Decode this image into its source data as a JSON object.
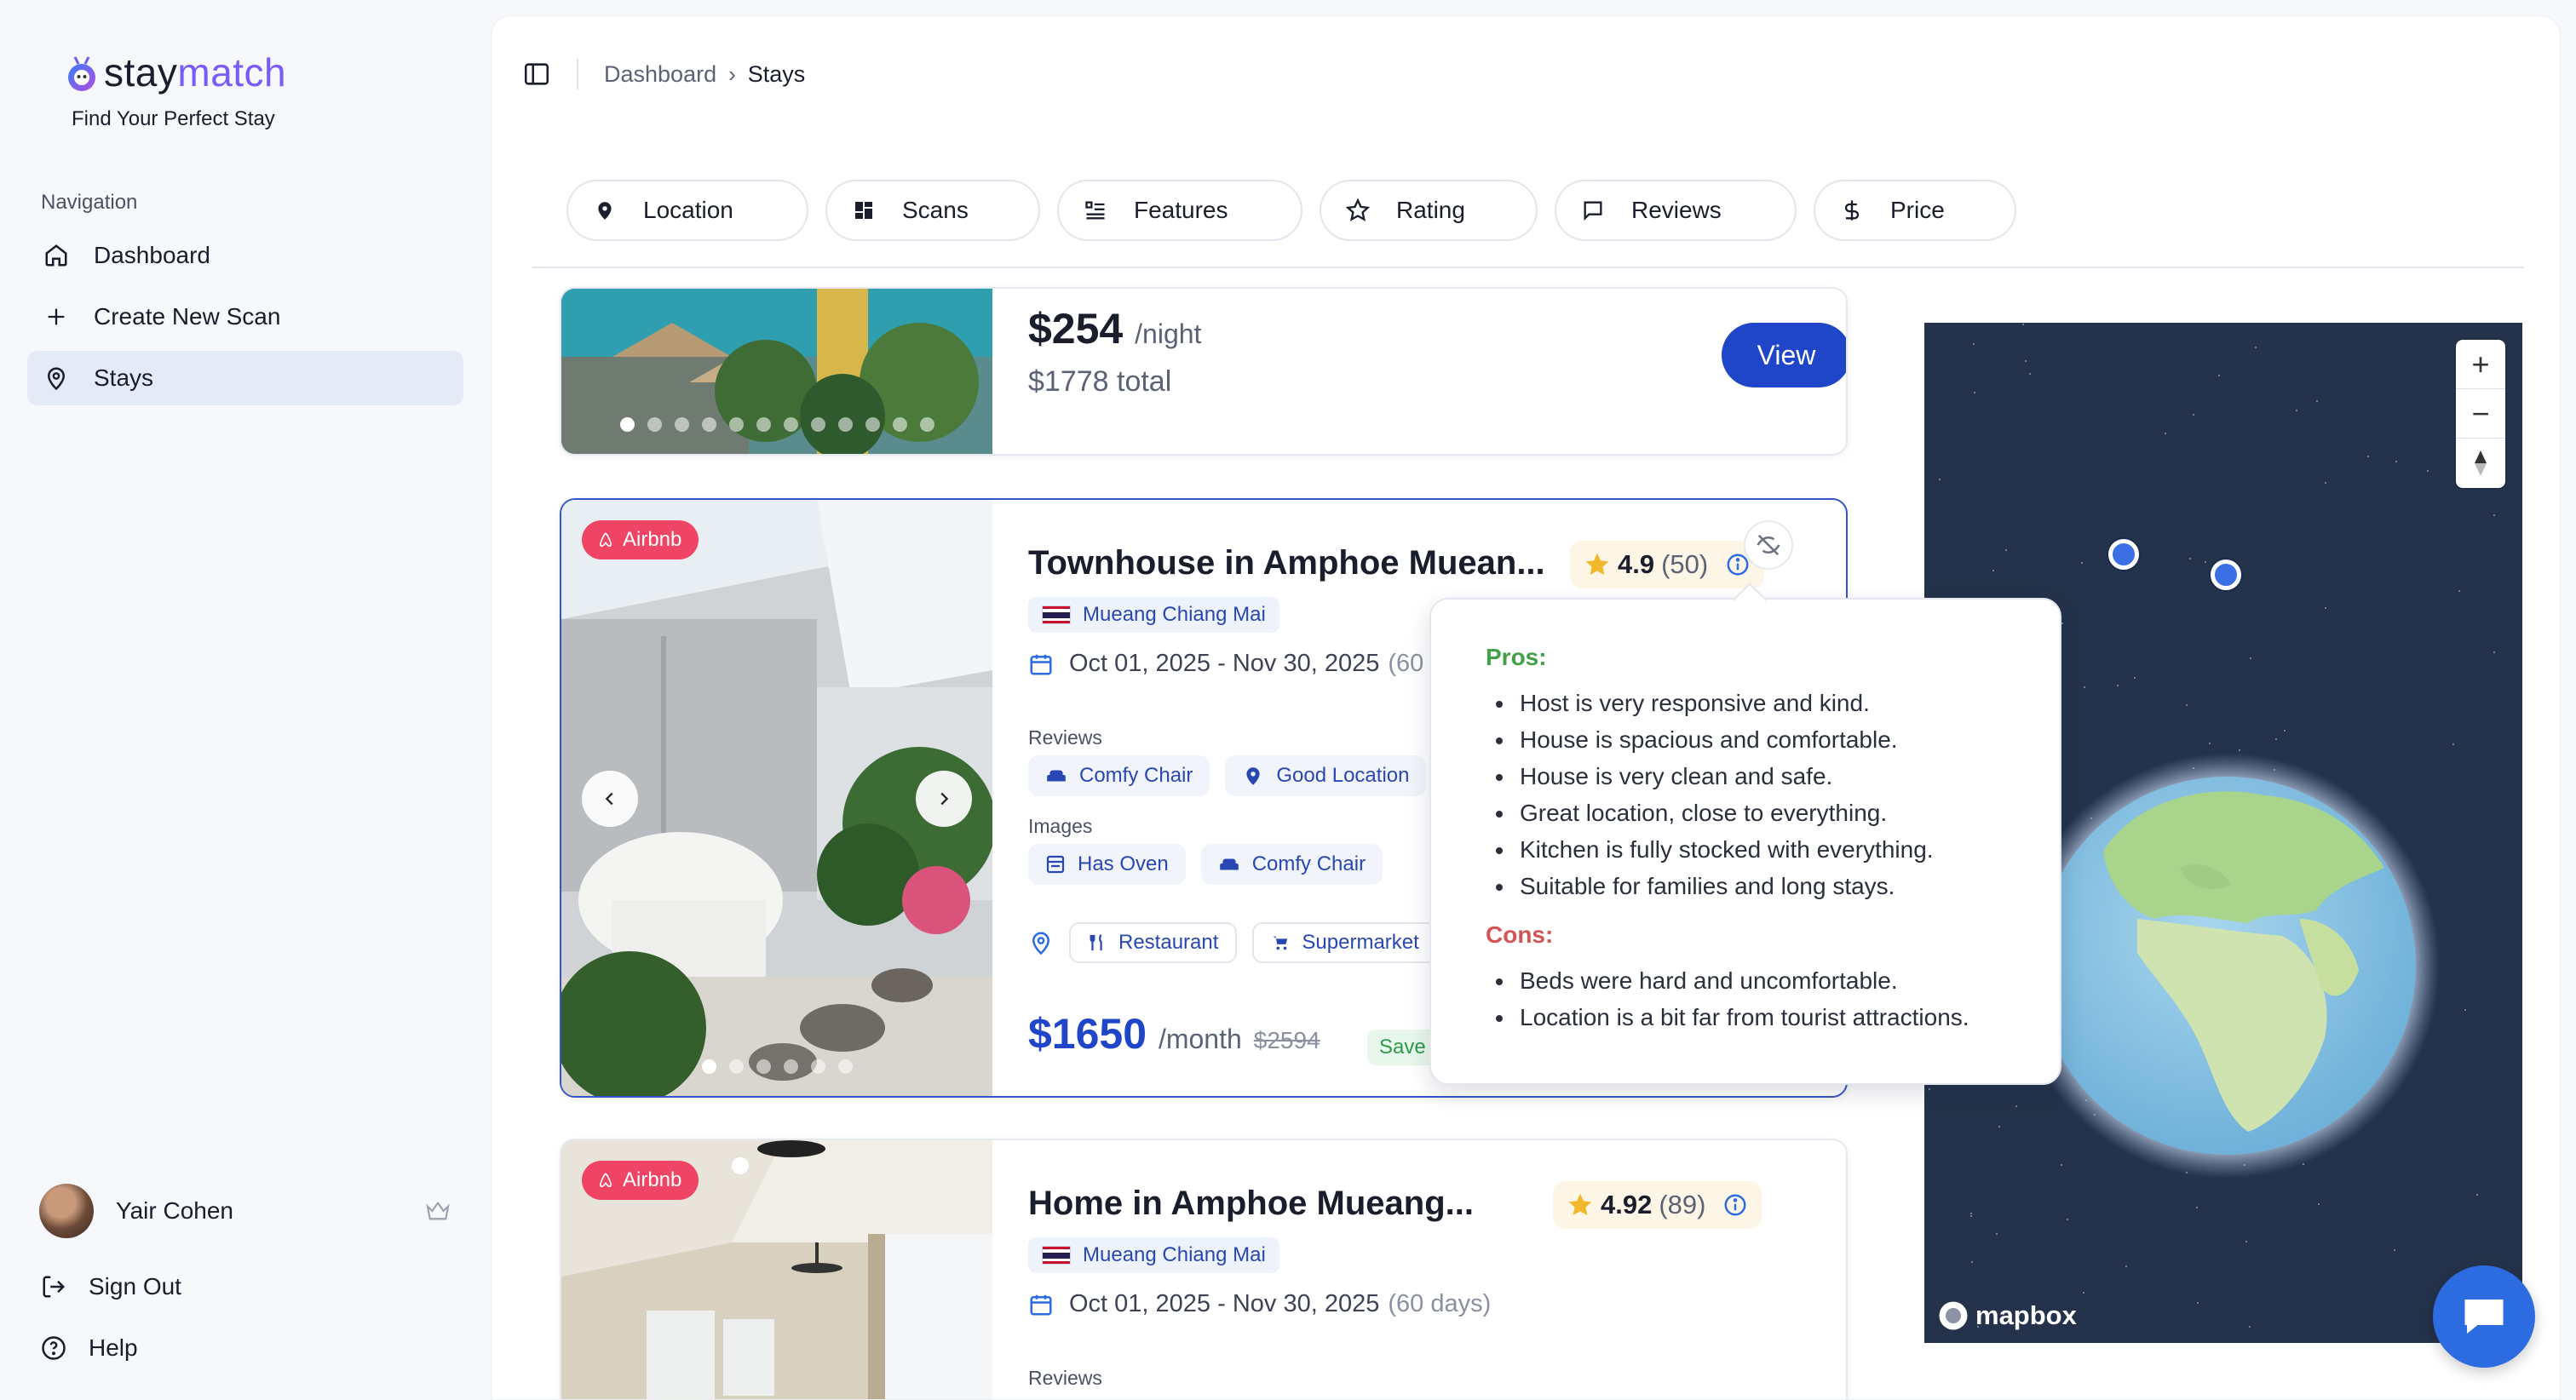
{
  "brand": {
    "name_prefix": "stay",
    "name_suffix": "match",
    "tagline": "Find Your Perfect Stay"
  },
  "sidebar": {
    "heading": "Navigation",
    "items": [
      {
        "label": "Dashboard",
        "icon": "home-icon"
      },
      {
        "label": "Create New Scan",
        "icon": "plus-icon"
      },
      {
        "label": "Stays",
        "icon": "map-pin-icon",
        "active": true
      }
    ],
    "user": {
      "name": "Yair Cohen"
    },
    "sign_out": "Sign Out",
    "help": "Help"
  },
  "breadcrumb": {
    "parent": "Dashboard",
    "current": "Stays"
  },
  "filters": [
    {
      "label": "Location",
      "icon": "map-pin-icon"
    },
    {
      "label": "Scans",
      "icon": "grid-icon"
    },
    {
      "label": "Features",
      "icon": "list-check-icon"
    },
    {
      "label": "Rating",
      "icon": "star-icon"
    },
    {
      "label": "Reviews",
      "icon": "message-icon"
    },
    {
      "label": "Price",
      "icon": "dollar-icon"
    }
  ],
  "listings": [
    {
      "price": "$254",
      "price_unit": "/night",
      "total": "$1778 total",
      "view_label": "View"
    },
    {
      "source": "Airbnb",
      "title": "Townhouse in Amphoe Muean...",
      "rating": "4.9",
      "rating_count": "(50)",
      "location": "Mueang Chiang Mai",
      "dates": "Oct 01, 2025 - Nov 30, 2025",
      "days": "(60",
      "reviews_label": "Reviews",
      "review_tags": [
        "Comfy Chair",
        "Good Location"
      ],
      "images_label": "Images",
      "image_tags": [
        "Has Oven",
        "Comfy Chair"
      ],
      "nearby_tags": [
        "Restaurant",
        "Supermarket"
      ],
      "price": "$1650",
      "price_unit": "/month",
      "old_price": "$2594",
      "save": "Save 3"
    },
    {
      "source": "Airbnb",
      "title": "Home in Amphoe Mueang...",
      "rating": "4.92",
      "rating_count": "(89)",
      "location": "Mueang Chiang Mai",
      "dates": "Oct 01, 2025 - Nov 30, 2025",
      "days": "(60 days)",
      "reviews_label": "Reviews"
    }
  ],
  "tooltip": {
    "pros_label": "Pros:",
    "pros": [
      "Host is very responsive and kind.",
      "House is spacious and comfortable.",
      "House is very clean and safe.",
      "Great location, close to everything.",
      "Kitchen is fully stocked with everything.",
      "Suitable for families and long stays."
    ],
    "cons_label": "Cons:",
    "cons": [
      "Beds were hard and uncomfortable.",
      "Location is a bit far from tourist attractions."
    ]
  },
  "map": {
    "attribution": "mapbox",
    "zoom_in": "+",
    "zoom_out": "−"
  },
  "colors": {
    "accent": "#1f46c8",
    "brand": "#7a5af8",
    "airbnb": "#ef4464",
    "pros": "#43a047",
    "cons": "#d35454"
  }
}
